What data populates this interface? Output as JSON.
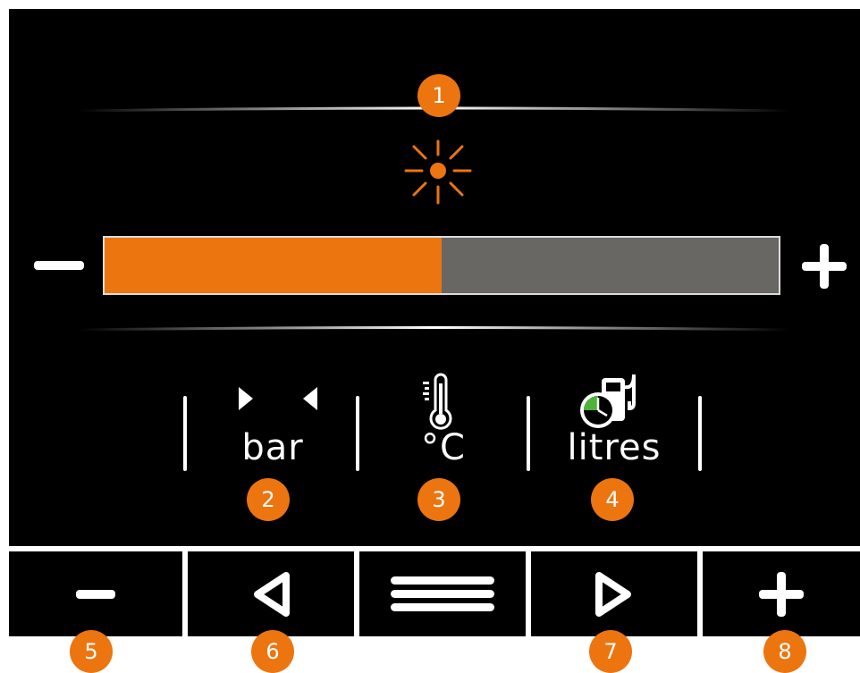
{
  "colors": {
    "accent": "#ec7510",
    "background": "#000000",
    "bar_empty": "#696764",
    "foreground": "#ffffff"
  },
  "brightness": {
    "level": 0.5,
    "minus_icon": "minus-icon",
    "plus_icon": "plus-icon",
    "icon": "sun-icon"
  },
  "units": [
    {
      "label": "bar",
      "icon": "pressure-arrows-icon"
    },
    {
      "label": "°C",
      "icon": "thermometer-icon"
    },
    {
      "label": "litres",
      "icon": "fuel-pump-clock-icon"
    }
  ],
  "badges": [
    "1",
    "2",
    "3",
    "4",
    "5",
    "6",
    "7",
    "8"
  ],
  "bottom_bar": [
    {
      "icon": "minus-icon"
    },
    {
      "icon": "triangle-left-icon"
    },
    {
      "icon": "menu-icon"
    },
    {
      "icon": "triangle-right-icon"
    },
    {
      "icon": "plus-icon"
    }
  ]
}
